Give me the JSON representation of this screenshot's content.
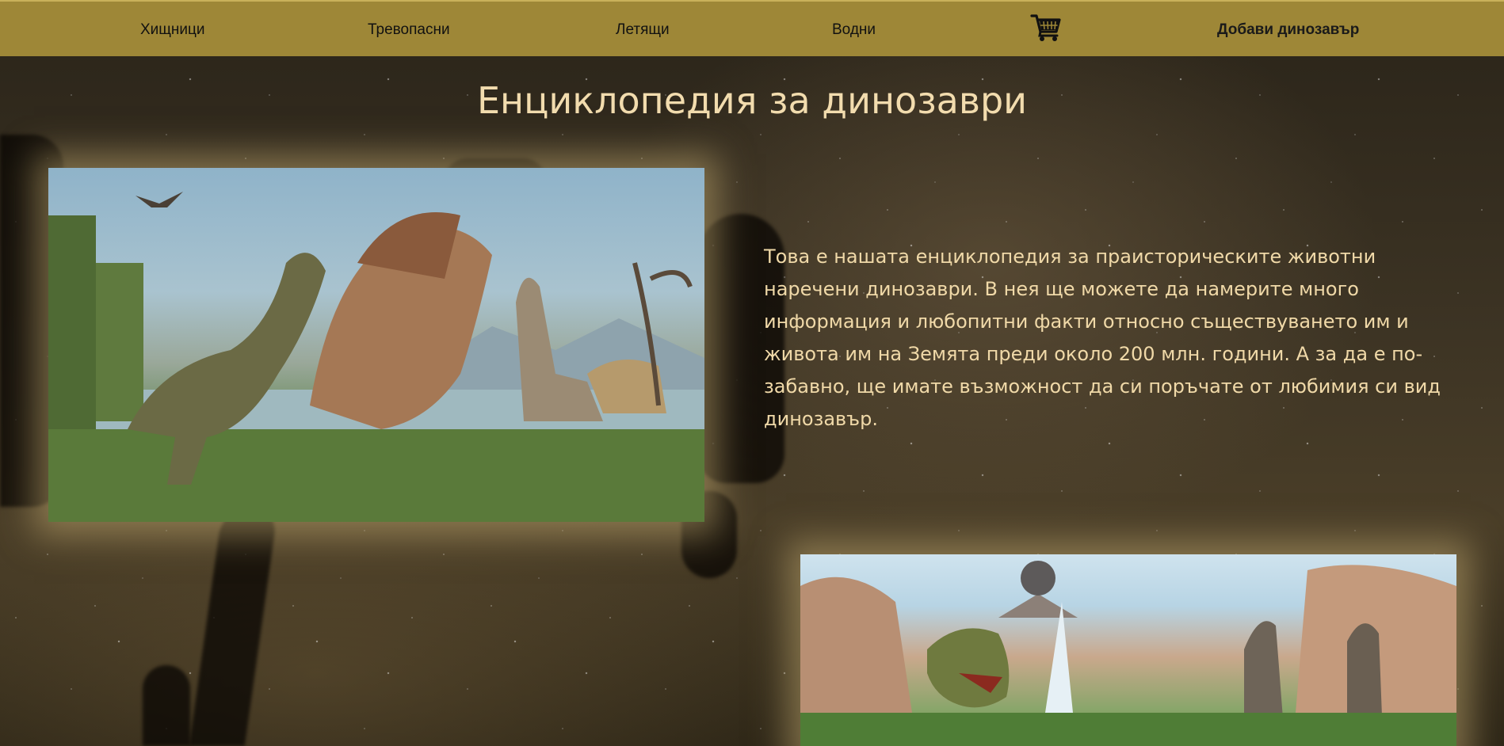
{
  "nav": {
    "items": [
      {
        "label": "Хищници"
      },
      {
        "label": "Тревопасни"
      },
      {
        "label": "Летящи"
      },
      {
        "label": "Водни"
      }
    ],
    "cart_icon": "shopping-cart-icon",
    "add_label": "Добави динозавър",
    "background_color": "#9e8737"
  },
  "main": {
    "title": "Енциклопедия за динозаври",
    "description": "Това е нашата енциклопедия за праисторическите животни наречени динозаври. В нея ще можете да намерите много информация и любопитни факти относно съществуването им и живота им на Земята преди около 200 млн. години. А за да е по-забавно, ще имате възможност да си поръчате от любимия си вид динозавър.",
    "title_color": "#f2dcae"
  }
}
